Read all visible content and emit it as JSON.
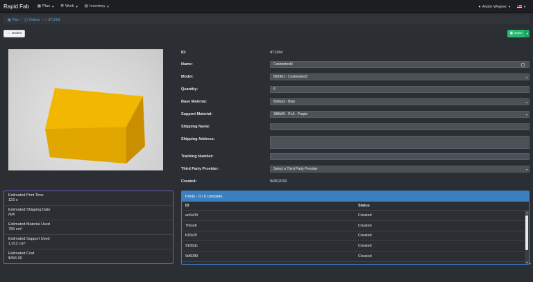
{
  "navbar": {
    "brand": "Rapid Fab",
    "menus": [
      {
        "label": "Plan",
        "icon": "plan-icon"
      },
      {
        "label": "Work",
        "icon": "wrench-icon"
      },
      {
        "label": "Inventory",
        "icon": "inventory-icon"
      }
    ],
    "user": "Andre Wegner",
    "language_flag": "us-flag-icon"
  },
  "breadcrumb": [
    {
      "label": "Plan",
      "icon": "plan-icon"
    },
    {
      "label": "Orders",
      "icon": "orders-icon"
    },
    {
      "label": "d7126d",
      "icon": "file-icon"
    }
  ],
  "toolbar": {
    "orders_label": "Orders",
    "save_label": "Save"
  },
  "estimates": [
    {
      "label": "Estimated Print Time",
      "value": "123 s"
    },
    {
      "label": "Estimated Shipping Date",
      "value": "N/A"
    },
    {
      "label": "Estimated Material Used",
      "value": "789 cm³"
    },
    {
      "label": "Estimated Support Used",
      "value": "1,012 cm³"
    },
    {
      "label": "Estimated Cost",
      "value": "$456.00"
    }
  ],
  "form": {
    "id_label": "ID:",
    "id_value": "d7126d",
    "name_label": "Name:",
    "name_value": "Cosimotest3",
    "model_label": "Model:",
    "model_value": "865961 - Cosimotest3",
    "quantity_label": "Quantity:",
    "quantity_value": "6",
    "base_material_label": "Base Material:",
    "base_material_value": "6b6ba3 - Blue",
    "support_material_label": "Support Material:",
    "support_material_value": "388b09 - PLA - Purple",
    "shipping_name_label": "Shipping Name:",
    "shipping_name_value": "",
    "shipping_address_label": "Shipping Address:",
    "shipping_address_value": "",
    "tracking_number_label": "Tracking Number:",
    "tracking_number_value": "",
    "third_party_label": "Third Party Provider:",
    "third_party_value": "Select a Third Party Provider",
    "created_label": "Created:",
    "created_value": "9/26/2016"
  },
  "prints": {
    "title": "Prints - 0 / 6 complete",
    "columns": [
      "ID",
      "Status"
    ],
    "rows": [
      {
        "id": "ac6e09",
        "status": "Created"
      },
      {
        "id": "7fbce8",
        "status": "Created"
      },
      {
        "id": "b15e2f",
        "status": "Created"
      },
      {
        "id": "9165dc",
        "status": "Created"
      },
      {
        "id": "9d6089",
        "status": "Created"
      }
    ]
  },
  "colors": {
    "accent_save": "#29b872",
    "prints_header": "#3b7fc0",
    "estimates_border": "#6c5fc7",
    "model_box": "#e8a900"
  }
}
